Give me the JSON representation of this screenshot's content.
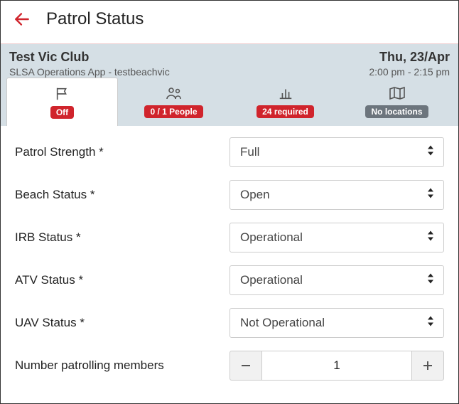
{
  "page": {
    "title": "Patrol Status"
  },
  "header": {
    "club": "Test Vic Club",
    "subtitle": "SLSA Operations App - testbeachvic",
    "date": "Thu, 23/Apr",
    "time": "2:00 pm - 2:15 pm"
  },
  "tabs": {
    "status": {
      "badge": "Off"
    },
    "people": {
      "badge": "0 / 1 People"
    },
    "stats": {
      "badge": "24 required"
    },
    "locations": {
      "badge": "No locations"
    }
  },
  "form": {
    "patrol_strength": {
      "label": "Patrol Strength *",
      "value": "Full"
    },
    "beach_status": {
      "label": "Beach Status *",
      "value": "Open"
    },
    "irb_status": {
      "label": "IRB Status *",
      "value": "Operational"
    },
    "atv_status": {
      "label": "ATV Status *",
      "value": "Operational"
    },
    "uav_status": {
      "label": "UAV Status *",
      "value": "Not Operational"
    },
    "members": {
      "label": "Number patrolling members",
      "value": "1"
    }
  }
}
